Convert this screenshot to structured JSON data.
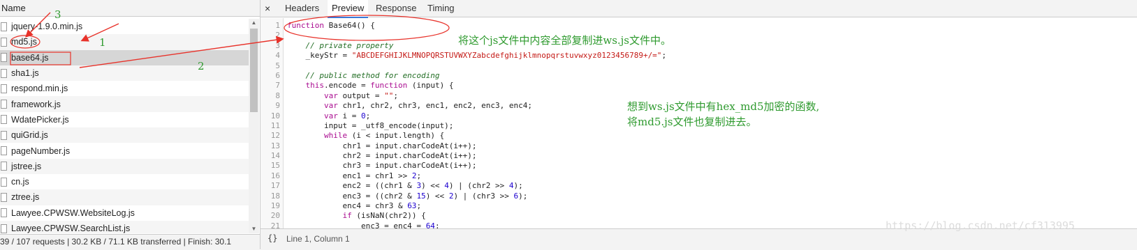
{
  "left_panel": {
    "header": "Name",
    "files": [
      "jquery-1.9.0.min.js",
      "md5.js",
      "base64.js",
      "sha1.js",
      "respond.min.js",
      "framework.js",
      "WdatePicker.js",
      "quiGrid.js",
      "pageNumber.js",
      "jstree.js",
      "cn.js",
      "ztree.js",
      "Lawyee.CPWSW.WebsiteLog.js",
      "Lawyee.CPWSW.SearchList.js"
    ],
    "selected_index": 2,
    "status": "39 / 107 requests  |  30.2 KB / 71.1 KB transferred  |  Finish: 30.1"
  },
  "tabs": {
    "close": "×",
    "items": [
      "Headers",
      "Preview",
      "Response",
      "Timing"
    ],
    "active": "Preview"
  },
  "code_lines": [
    {
      "n": "1",
      "t": "function Base64() {"
    },
    {
      "n": "2",
      "t": ""
    },
    {
      "n": "3",
      "t": "    // private property"
    },
    {
      "n": "4",
      "t": "    _keyStr = \"ABCDEFGHIJKLMNOPQRSTUVWXYZabcdefghijklmnopqrstuvwxyz0123456789+/=\";"
    },
    {
      "n": "5",
      "t": ""
    },
    {
      "n": "6",
      "t": "    // public method for encoding"
    },
    {
      "n": "7",
      "t": "    this.encode = function (input) {"
    },
    {
      "n": "8",
      "t": "        var output = \"\";"
    },
    {
      "n": "9",
      "t": "        var chr1, chr2, chr3, enc1, enc2, enc3, enc4;"
    },
    {
      "n": "10",
      "t": "        var i = 0;"
    },
    {
      "n": "11",
      "t": "        input = _utf8_encode(input);"
    },
    {
      "n": "12",
      "t": "        while (i < input.length) {"
    },
    {
      "n": "13",
      "t": "            chr1 = input.charCodeAt(i++);"
    },
    {
      "n": "14",
      "t": "            chr2 = input.charCodeAt(i++);"
    },
    {
      "n": "15",
      "t": "            chr3 = input.charCodeAt(i++);"
    },
    {
      "n": "16",
      "t": "            enc1 = chr1 >> 2;"
    },
    {
      "n": "17",
      "t": "            enc2 = ((chr1 & 3) << 4) | (chr2 >> 4);"
    },
    {
      "n": "18",
      "t": "            enc3 = ((chr2 & 15) << 2) | (chr3 >> 6);"
    },
    {
      "n": "19",
      "t": "            enc4 = chr3 & 63;"
    },
    {
      "n": "20",
      "t": "            if (isNaN(chr2)) {"
    },
    {
      "n": "21",
      "t": "                enc3 = enc4 = 64;"
    }
  ],
  "bottom_bar": {
    "bracket_icon": "{}",
    "cursor": "Line 1, Column 1"
  },
  "annotations": {
    "label_1": "1",
    "label_2": "2",
    "label_3": "3",
    "note_copy": "将这个js文件中内容全部复制进ws.js文件中。",
    "note_md5_line1": "想到ws.js文件中有hex_md5加密的函数,",
    "note_md5_line2": "将md5.js文件也复制进去。",
    "watermark": "https://blog.csdn.net/cf313995",
    "color": "#2e9a2e",
    "marker_color": "#e8322a"
  }
}
